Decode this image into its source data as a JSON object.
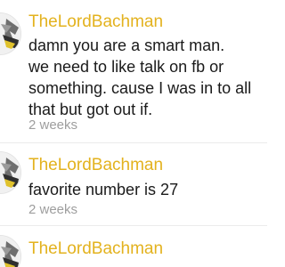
{
  "comments": [
    {
      "username": "TheLordBachman",
      "body": "damn you are a smart man.\nwe need to like talk on fb or\nsomething. cause I was in to all\nthat but got out if.",
      "timestamp": "2 weeks"
    },
    {
      "username": "TheLordBachman",
      "body": "favorite number is 27",
      "timestamp": "2 weeks"
    },
    {
      "username": "TheLordBachman"
    }
  ],
  "colors": {
    "username": "#e3b21e",
    "body": "#1a1a1a",
    "timestamp": "#9e9e9e"
  }
}
